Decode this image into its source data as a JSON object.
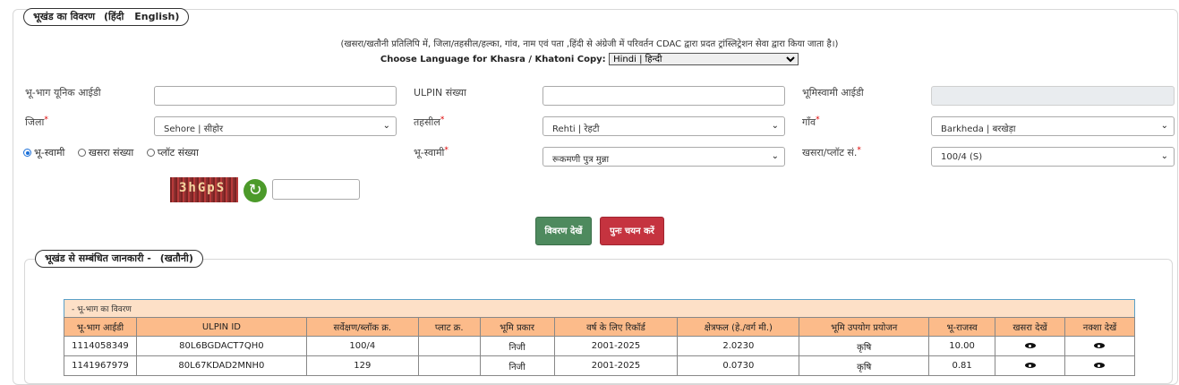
{
  "section1": {
    "legend": "भूखंड का विवरण",
    "legend_hindi": "(हिंदी",
    "legend_english": "English)"
  },
  "note": "(खसरा/खतौनी प्रतिलिपि में, जिला/तहसील/हल्का, गांव, नाम एवं पता ,हिंदी से अंग्रेजी में परिवर्तन CDAC द्वारा प्रदत ट्रांस्लिट्रेशन सेवा द्वारा किया जाता है।)",
  "language": {
    "label": "Choose Language for Khasra / Khatoni Copy:",
    "selected": "Hindi | हिन्दी"
  },
  "form": {
    "unique_id_label": "भू-भाग यूनिक आईडी",
    "ulpin_label": "ULPIN संख्या",
    "owner_id_label": "भूमिस्वामी आईडी",
    "district_label": "जिला",
    "district_value": "Sehore | सीहोर",
    "tehsil_label": "तहसील",
    "tehsil_value": "Rehti | रेहटी",
    "village_label": "गाँव",
    "village_value": "Barkheda | बरखेड़ा",
    "radio_owner": "भू-स्वामी",
    "radio_khasra": "खसरा संख्या",
    "radio_plot": "प्लॉट संख्या",
    "owner_label": "भू-स्वामी",
    "owner_value": "रूकमणी पुत्र मुन्ना",
    "khasra_label": "खसरा/प्लॉट सं.",
    "khasra_value": "100/4 (S)",
    "required_mark": "*"
  },
  "captcha": {
    "text": "3hGpS"
  },
  "buttons": {
    "view": "विवरण देखें",
    "reset": "पुनः चयन करें"
  },
  "section2": {
    "legend": "भूखंड से सम्बंधित जानकारी -",
    "legend_sub": "(खतौनी)"
  },
  "table": {
    "caption": "- भू-भाग का विवरण",
    "headers": [
      "भू-भाग आईडी",
      "ULPIN ID",
      "सर्वेक्षण/ब्लॉक क्र.",
      "प्लाट क्र.",
      "भूमि प्रकार",
      "वर्ष के लिए रिकॉर्ड",
      "क्षेत्रफल (हे./वर्ग मी.)",
      "भूमि उपयोग प्रयोजन",
      "भू-राजस्व",
      "खसरा देखें",
      "नक्शा देखें"
    ],
    "rows": [
      [
        "1114058349",
        "80L6BGDACT7QH0",
        "100/4",
        "",
        "निजी",
        "2001-2025",
        "2.0230",
        "कृषि",
        "10.00"
      ],
      [
        "1141967979",
        "80L67KDAD2MNH0",
        "129",
        "",
        "निजी",
        "2001-2025",
        "0.0730",
        "कृषि",
        "0.81"
      ]
    ]
  }
}
